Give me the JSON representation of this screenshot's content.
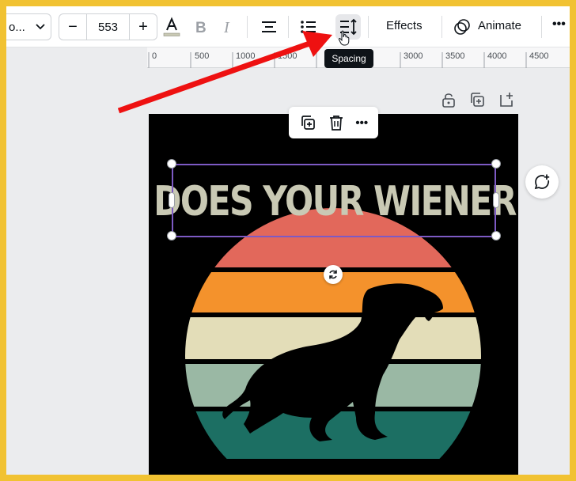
{
  "toolbar": {
    "font_name": "o...",
    "font_size": "553",
    "decrease_label": "−",
    "increase_label": "+",
    "effects_label": "Effects",
    "animate_label": "Animate",
    "more_label": "•••"
  },
  "tooltip": {
    "text": "Spacing"
  },
  "ruler": {
    "ticks": [
      "0",
      "500",
      "1000",
      "1500",
      "3000",
      "3500",
      "4000",
      "4500"
    ]
  },
  "context_toolbar": {
    "more_label": "•••"
  },
  "canvas": {
    "headline_text": "DOES YOUR WIENER",
    "stripe_colors": [
      "#e2685b",
      "#f4922c",
      "#e3ddb8",
      "#9ab8a4",
      "#1c6f63"
    ],
    "background_color": "#000000"
  },
  "colors": {
    "frame": "#f1c232",
    "selection": "#7d5ac4",
    "arrow": "#ee1111"
  }
}
